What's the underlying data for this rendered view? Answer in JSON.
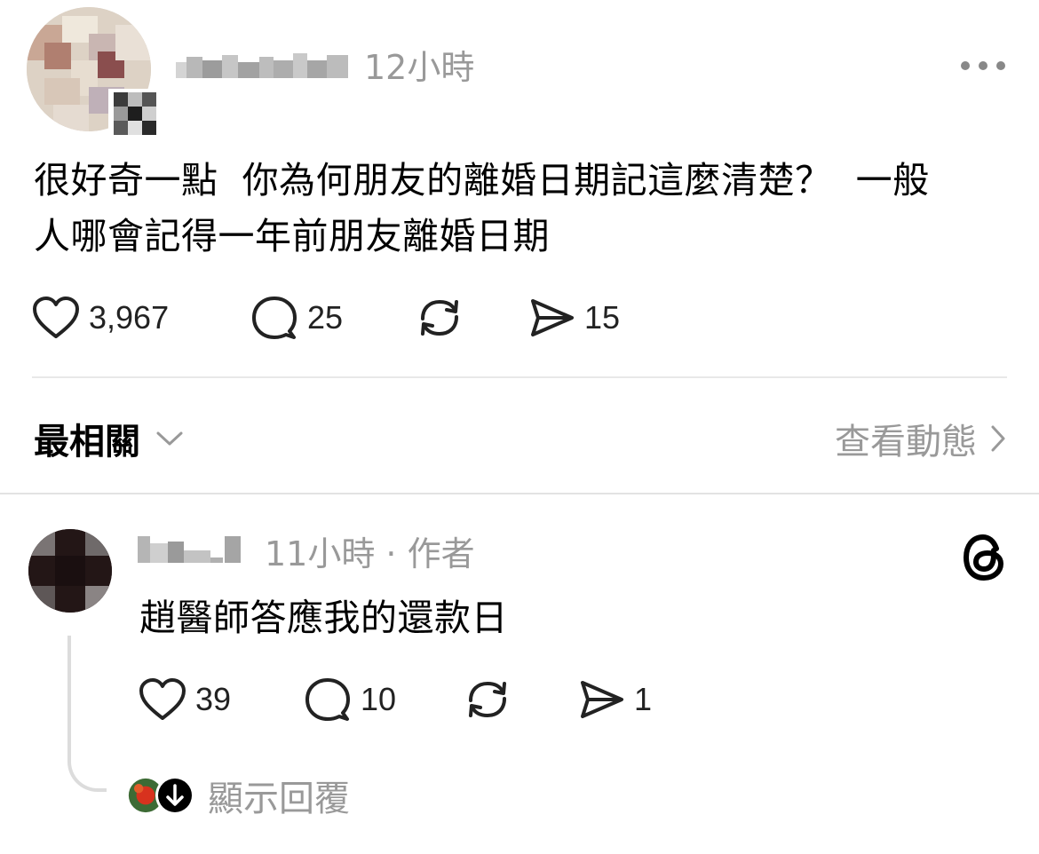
{
  "post": {
    "time": "12小時",
    "text_lines": [
      "很好奇一點  你為何朋友的離婚日期記這麼清楚？  一般",
      "人哪會記得一年前朋友離婚日期"
    ],
    "likes": "3,967",
    "comments": "25",
    "shares": "15"
  },
  "sort": {
    "label": "最相關",
    "view_activity": "查看動態"
  },
  "reply": {
    "meta": "11小時 · 作者",
    "text": "趙醫師答應我的還款日",
    "likes": "39",
    "comments": "10",
    "shares": "1",
    "show_replies": "顯示回覆"
  },
  "icons": {
    "like": "heart-icon",
    "comment": "comment-bubble-icon",
    "repost": "repost-icon",
    "share": "send-icon",
    "more": "more-dots-icon",
    "threads": "threads-logo-icon",
    "chevron_down": "chevron-down-icon",
    "chevron_right": "chevron-right-icon"
  },
  "colors": {
    "text": "#000000",
    "muted": "#999999",
    "divider": "#e8e8e8"
  }
}
